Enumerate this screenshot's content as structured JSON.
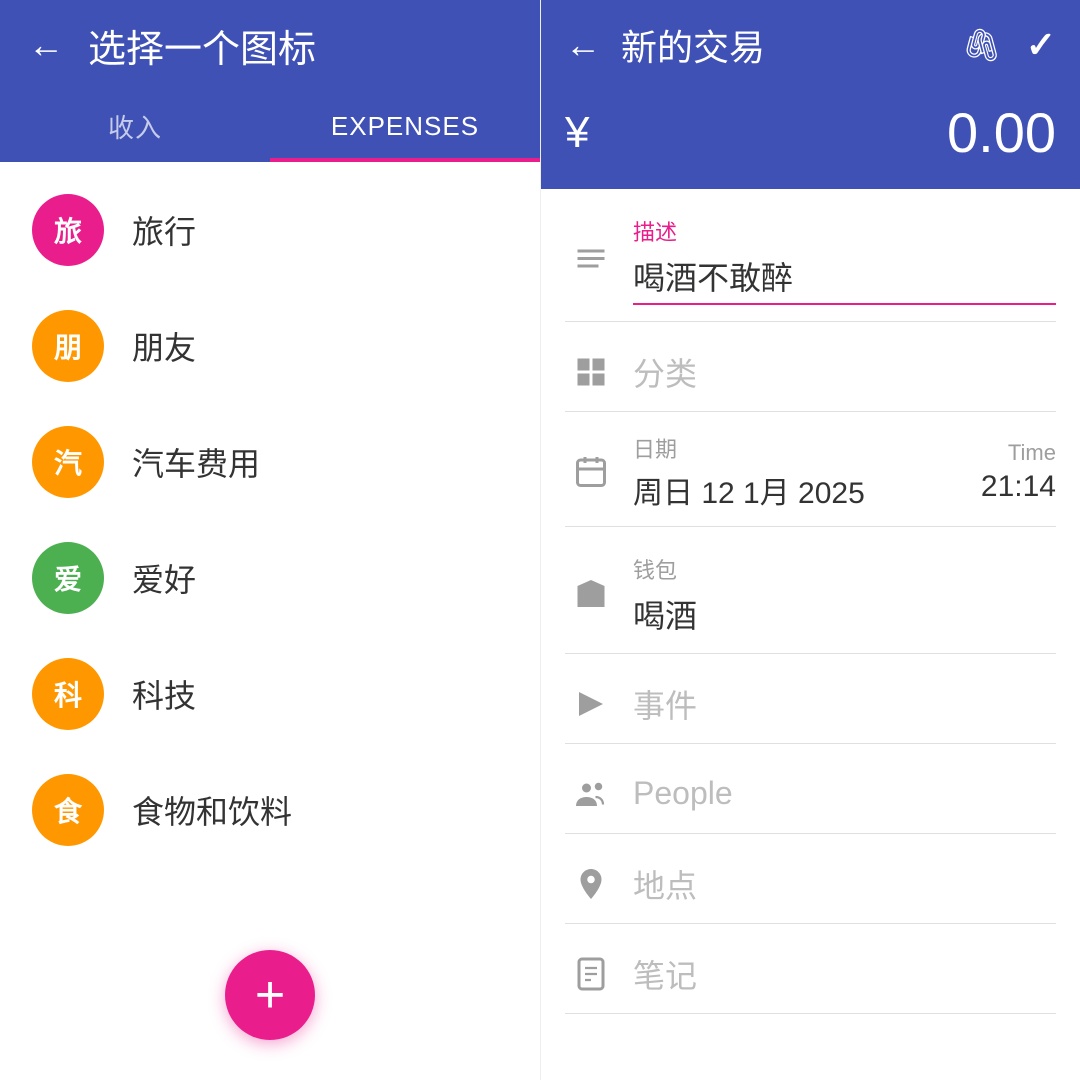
{
  "left": {
    "header": {
      "back_label": "←",
      "title": "选择一个图标"
    },
    "tabs": [
      {
        "id": "income",
        "label": "收入",
        "active": false
      },
      {
        "id": "expenses",
        "label": "EXPENSES",
        "active": true
      }
    ],
    "categories": [
      {
        "id": "travel",
        "icon_char": "旅",
        "color": "#e91e8c",
        "label": "旅行"
      },
      {
        "id": "friends",
        "icon_char": "朋",
        "color": "#ff9800",
        "label": "朋友"
      },
      {
        "id": "car",
        "icon_char": "汽",
        "color": "#ff9800",
        "label": "汽车费用"
      },
      {
        "id": "hobby",
        "icon_char": "爱",
        "color": "#4caf50",
        "label": "爱好"
      },
      {
        "id": "tech",
        "icon_char": "科",
        "color": "#ff9800",
        "label": "科技"
      },
      {
        "id": "food",
        "icon_char": "食",
        "color": "#ff9800",
        "label": "食物和饮料"
      }
    ],
    "fab_label": "+"
  },
  "right": {
    "header": {
      "back_label": "←",
      "title": "新的交易",
      "attach_icon": "📎",
      "check_icon": "✓"
    },
    "amount": {
      "currency": "¥",
      "value": "0.00"
    },
    "form": {
      "description": {
        "label": "描述",
        "value": "喝酒不敢醉",
        "icon": "lines"
      },
      "category": {
        "label": "分类",
        "value": "",
        "icon": "grid"
      },
      "date": {
        "label": "日期",
        "value": "周日 12 1月 2025",
        "time_label": "Time",
        "time_value": "21:14",
        "icon": "calendar"
      },
      "wallet": {
        "label": "钱包",
        "value": "喝酒",
        "icon": "folder"
      },
      "event": {
        "label": "事件",
        "value": "",
        "icon": "flag"
      },
      "people": {
        "label": "People",
        "value": "",
        "icon": "people"
      },
      "location": {
        "label": "地点",
        "value": "",
        "icon": "location"
      },
      "note": {
        "label": "笔记",
        "value": "",
        "icon": "note"
      }
    }
  }
}
